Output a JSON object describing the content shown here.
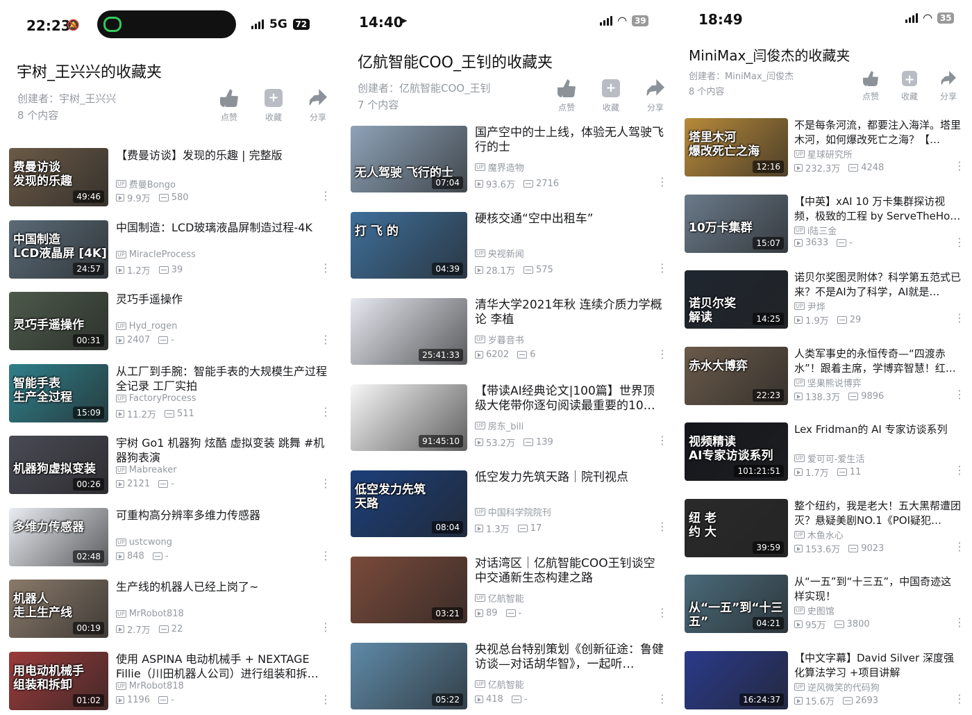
{
  "panels": [
    {
      "status": {
        "time": "22:23",
        "network": "5G",
        "battery": "72"
      },
      "title": "宇树_王兴兴的收藏夹",
      "creator": "创建者：宇树_王兴兴",
      "count": "8 个内容",
      "actions": {
        "like": "点赞",
        "fav": "收藏",
        "share": "分享"
      },
      "items": [
        {
          "title": "【费曼访谈】发现的乐趣 | 完整版",
          "uploader": "费曼Bongo",
          "views": "9.9万",
          "danmaku": "580",
          "duration": "49:46",
          "caption": "费曼访谈\n发现的乐趣",
          "bg": "#6b5a47"
        },
        {
          "title": "中国制造：LCD玻璃液晶屏制造过程-4K",
          "uploader": "MiracleProcess",
          "views": "1.2万",
          "danmaku": "39",
          "duration": "24:57",
          "caption": "中国制造\nLCD液晶屏 [4K]",
          "bg": "#5a6b78"
        },
        {
          "title": "灵巧手遥操作",
          "uploader": "Hyd_rogen",
          "views": "2407",
          "danmaku": "-",
          "duration": "00:31",
          "caption": "\n灵巧手遥操作",
          "bg": "#4c5a4a"
        },
        {
          "title": "从工厂到手腕：智能手表的大规模生产过程全记录 工厂实拍",
          "uploader": "FactoryProcess",
          "views": "11.2万",
          "danmaku": "511",
          "duration": "15:09",
          "caption": "智能手表\n生产全过程",
          "bg": "#2f7f8a"
        },
        {
          "title": "宇树 Go1 机器狗 炫酷 虚拟变装 跳舞 #机器狗表演",
          "uploader": "Mabreaker",
          "views": "2121",
          "danmaku": "-",
          "duration": "00:26",
          "caption": "\n机器狗虚拟变装",
          "bg": "#4a4a55"
        },
        {
          "title": "可重构高分辨率多维力传感器",
          "uploader": "ustcwong",
          "views": "848",
          "danmaku": "-",
          "duration": "02:48",
          "caption": "多维力传感器",
          "bg": "#e9ecf2"
        },
        {
          "title": "生产线的机器人已经上岗了~",
          "uploader": "MrRobot818",
          "views": "2.7万",
          "danmaku": "22",
          "duration": "00:19",
          "caption": "机器人\n走上生产线",
          "bg": "#8a7a6a"
        },
        {
          "title": "使用 ASPINA 电动机械手 + NEXTAGE Fillie（川田机器人公司）进行组装和拆卸…",
          "uploader": "MrRobot818",
          "views": "1196",
          "danmaku": "-",
          "duration": "01:02",
          "caption": "用电动机械手\n组装和拆卸",
          "bg": "#9a3a3a"
        }
      ]
    },
    {
      "status": {
        "time": "14:40",
        "network": "",
        "battery": "39"
      },
      "title": "亿航智能COO_王钊的收藏夹",
      "creator": "创建者：亿航智能COO_王钊",
      "count": "7 个内容",
      "actions": {
        "like": "点赞",
        "fav": "收藏",
        "share": "分享"
      },
      "items": [
        {
          "title": "国产空中的士上线，体验无人驾驶飞行的士",
          "uploader": "魔界造物",
          "views": "93.6万",
          "danmaku": "2716",
          "duration": "07:04",
          "caption": "\n\n无人驾驶 飞行的士",
          "bg": "#8ea3b8"
        },
        {
          "title": "硬核交通“空中出租车”",
          "uploader": "央视新闻",
          "views": "28.1万",
          "danmaku": "575",
          "duration": "04:39",
          "caption": "打 飞 的",
          "bg": "#3f6f9a"
        },
        {
          "title": "清华大学2021年秋 连续介质力学概论 李植",
          "uploader": "岁暮音书",
          "views": "6202",
          "danmaku": "6",
          "duration": "25:41:33",
          "caption": "",
          "bg": "#e6e8f0"
        },
        {
          "title": "【带读AI经典论文|100篇】世界顶级大佬带你逐句阅读最重要的10…",
          "uploader": "房东_bili",
          "views": "53.2万",
          "danmaku": "139",
          "duration": "91:45:10",
          "caption": "",
          "bg": "#f7f7f7"
        },
        {
          "title": "低空发力先筑天路｜院刊视点",
          "uploader": "中国科学院院刊",
          "views": "1.3万",
          "danmaku": "17",
          "duration": "08:04",
          "caption": "低空发力先筑\n天路",
          "bg": "#1c3f7a"
        },
        {
          "title": "对话湾区｜亿航智能COO王钊谈空中交通新生态构建之路",
          "uploader": "亿航智能",
          "views": "89",
          "danmaku": "-",
          "duration": "03:21",
          "caption": "",
          "bg": "#7a4a3a"
        },
        {
          "title": "央视总台特别策划《创新征途：鲁健访谈—对话胡华智》，一起听…",
          "uploader": "亿航智能",
          "views": "418",
          "danmaku": "-",
          "duration": "05:22",
          "caption": "",
          "bg": "#5f8aa8"
        }
      ]
    },
    {
      "status": {
        "time": "18:49",
        "network": "",
        "battery": "35"
      },
      "title": "MiniMax_闫俊杰的收藏夹",
      "creator": "创建者：MiniMax_闫俊杰",
      "count": "8 个内容",
      "actions": {
        "like": "点赞",
        "fav": "收藏",
        "share": "分享"
      },
      "items": [
        {
          "title": "不是每条河流，都要注入海洋。塔里木河，如何爆改死亡之海？【…",
          "uploader": "星球研究所",
          "views": "232.3万",
          "danmaku": "4248",
          "duration": "12:16",
          "caption": "塔里木河\n爆改死亡之海",
          "bg": "#b88a3a"
        },
        {
          "title": "【中英】xAI 10 万卡集群探访视频，极致的工程 by ServeTheHo…",
          "uploader": "i陆三金",
          "views": "3633",
          "danmaku": "-",
          "duration": "15:07",
          "caption": "\n10万卡集群",
          "bg": "#6a7a8a"
        },
        {
          "title": "诺贝尔奖图灵附体？科学第五范式已来？不是AI为了科学，AI就是…",
          "uploader": "尹烨",
          "views": "1.9万",
          "danmaku": "29",
          "duration": "14:25",
          "caption": "\n诺贝尔奖\n解读",
          "bg": "#1f2630"
        },
        {
          "title": "人类军事史的永恒传奇—“四渡赤水”！跟着主席，学博弈智慧！红…",
          "uploader": "坚果熊说博弈",
          "views": "138.3万",
          "danmaku": "9896",
          "duration": "22:23",
          "caption": "赤水大博弈",
          "bg": "#6a5a4a"
        },
        {
          "title": "Lex Fridman的 AI 专家访谈系列",
          "uploader": "爱可可-爱生活",
          "views": "1.7万",
          "danmaku": "11",
          "duration": "101:21:51",
          "caption": "视频精读\nAI专家访谈系列",
          "bg": "#14161c"
        },
        {
          "title": "整个纽约，我是老大！五大黑帮遭团灭？悬疑美剧NO.1《POI疑犯…",
          "uploader": "木鱼水心",
          "views": "153.6万",
          "danmaku": "9023",
          "duration": "39:59",
          "caption": "纽       老\n约       大",
          "bg": "#2a2a2a"
        },
        {
          "title": "从“一五”到“十三五”，中国奇迹这样实现！",
          "uploader": "史图馆",
          "views": "95万",
          "danmaku": "3800",
          "duration": "04:21",
          "caption": "\n从“一五”到“十三五”",
          "bg": "#4a6a7a"
        },
        {
          "title": "【中文字幕】David Silver 深度强化算法学习 +项目讲解",
          "uploader": "逆风微笑的代码狗",
          "views": "15.6万",
          "danmaku": "2693",
          "duration": "16:24:37",
          "caption": "",
          "bg": "#2a3a8a"
        }
      ]
    }
  ]
}
